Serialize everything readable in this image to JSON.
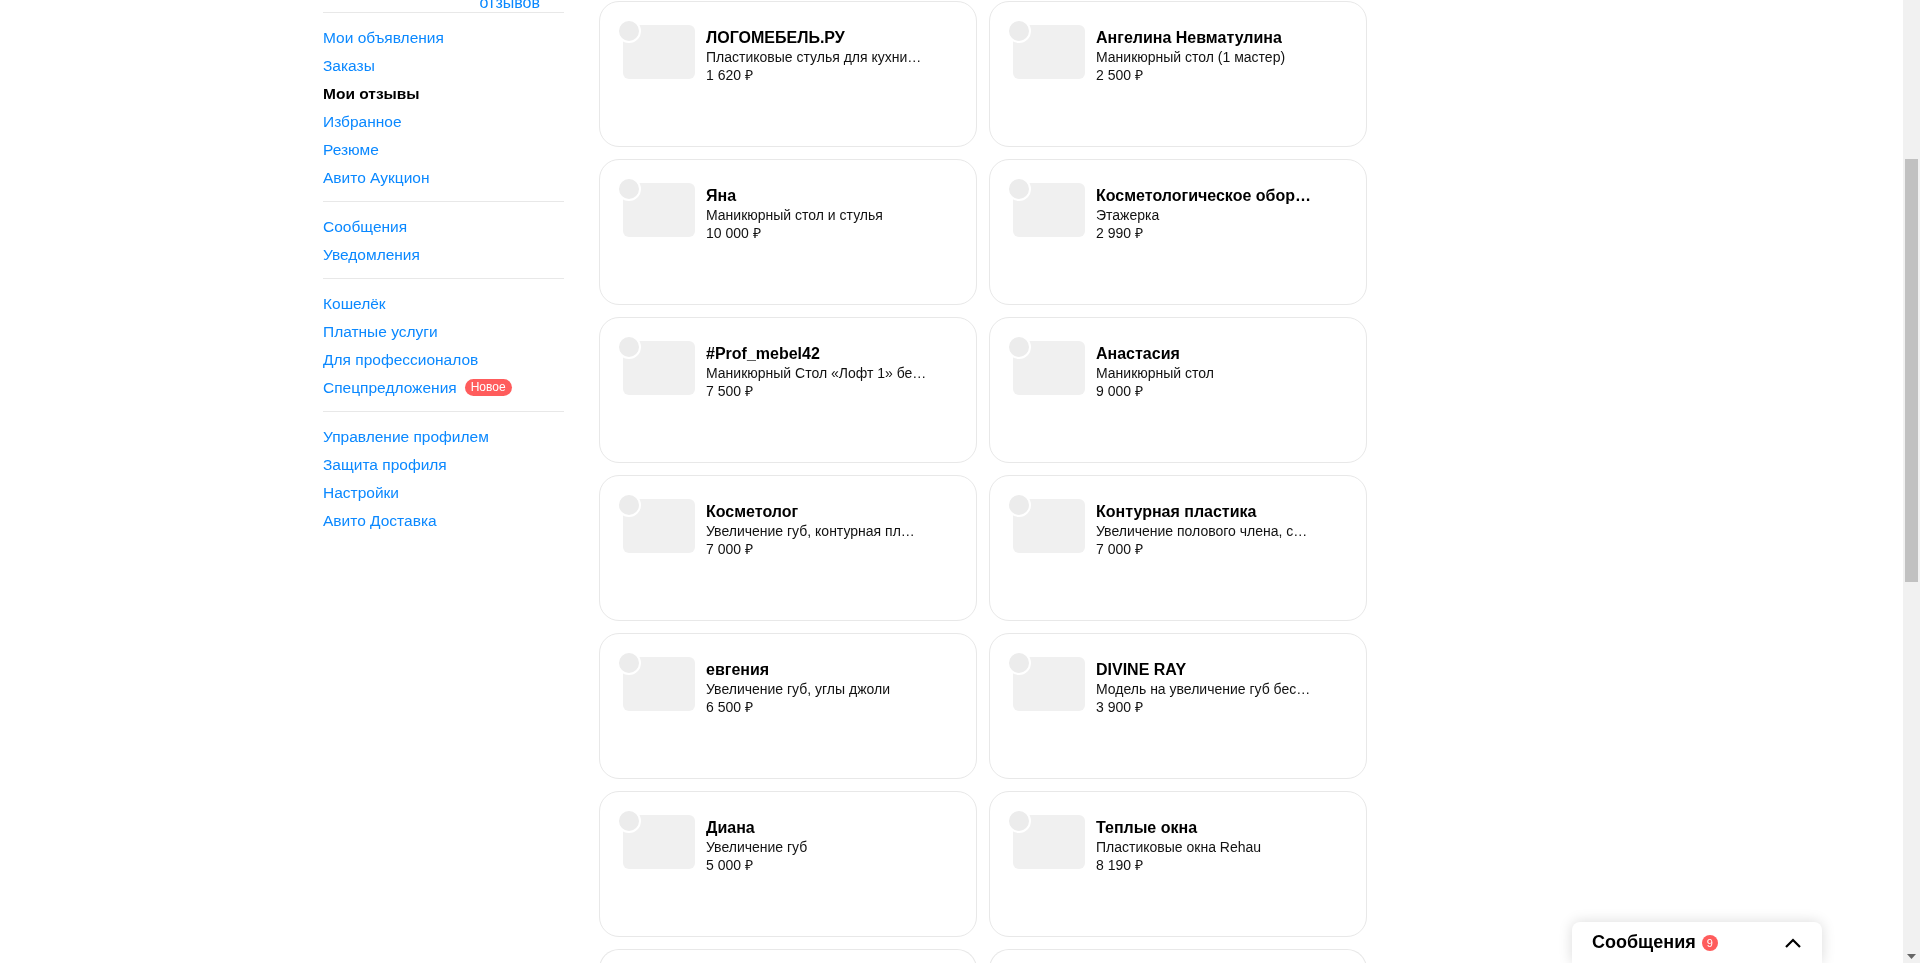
{
  "header_fragment": {
    "reviews_link": "отзывов"
  },
  "sidebar": {
    "groups": [
      {
        "items": [
          {
            "label": "Мои объявления",
            "selected": false
          },
          {
            "label": "Заказы",
            "selected": false
          },
          {
            "label": "Мои отзывы",
            "selected": true
          },
          {
            "label": "Избранное",
            "selected": false
          },
          {
            "label": "Резюме",
            "selected": false
          },
          {
            "label": "Авито Аукцион",
            "selected": false
          }
        ]
      },
      {
        "items": [
          {
            "label": "Сообщения",
            "selected": false
          },
          {
            "label": "Уведомления",
            "selected": false
          }
        ]
      },
      {
        "items": [
          {
            "label": "Кошелёк",
            "selected": false
          },
          {
            "label": "Платные услуги",
            "selected": false
          },
          {
            "label": "Для профессионалов",
            "selected": false
          },
          {
            "label": "Спецпредложения",
            "selected": false,
            "badge": "Новое"
          }
        ]
      },
      {
        "items": [
          {
            "label": "Управление профилем",
            "selected": false
          },
          {
            "label": "Защита профиля",
            "selected": false
          },
          {
            "label": "Настройки",
            "selected": false
          },
          {
            "label": "Авито Доставка",
            "selected": false
          }
        ]
      }
    ]
  },
  "cards": [
    {
      "title": "ЛОГОМЕБЕЛЬ.РУ",
      "subtitle": "Пластиковые стулья для кухни…",
      "price": "1 620 ₽"
    },
    {
      "title": "Ангелина Невматулина",
      "subtitle": "Маникюрный стол (1 мастер)",
      "price": "2 500 ₽"
    },
    {
      "title": "Яна",
      "subtitle": "Маникюрный стол и стулья",
      "price": "10 000 ₽"
    },
    {
      "title": "Косметологическое обор…",
      "subtitle": "Этажерка",
      "price": "2 990 ₽"
    },
    {
      "title": "#Prof_mebel42",
      "subtitle": "Маникюрный Стол «Лофт 1» бе…",
      "price": "7 500 ₽"
    },
    {
      "title": "Анастасия",
      "subtitle": "Маникюрный стол",
      "price": "9 000 ₽"
    },
    {
      "title": "Косметолог",
      "subtitle": "Увеличение губ, контурная пл…",
      "price": "7 000 ₽"
    },
    {
      "title": "Контурная пластика",
      "subtitle": "Увеличение полового члена, с…",
      "price": "7 000 ₽"
    },
    {
      "title": "евгения",
      "subtitle": "Увеличение губ, углы джоли",
      "price": "6 500 ₽"
    },
    {
      "title": "DIVINE RAY",
      "subtitle": "Модель на увеличение губ бес…",
      "price": "3 900 ₽"
    },
    {
      "title": "Диана",
      "subtitle": "Увеличение губ",
      "price": "5 000 ₽"
    },
    {
      "title": "Теплые окна",
      "subtitle": "Пластиковые окна Rehau",
      "price": "8 190 ₽"
    }
  ],
  "messages_widget": {
    "title": "Сообщения",
    "count": "9",
    "expanded": false
  }
}
